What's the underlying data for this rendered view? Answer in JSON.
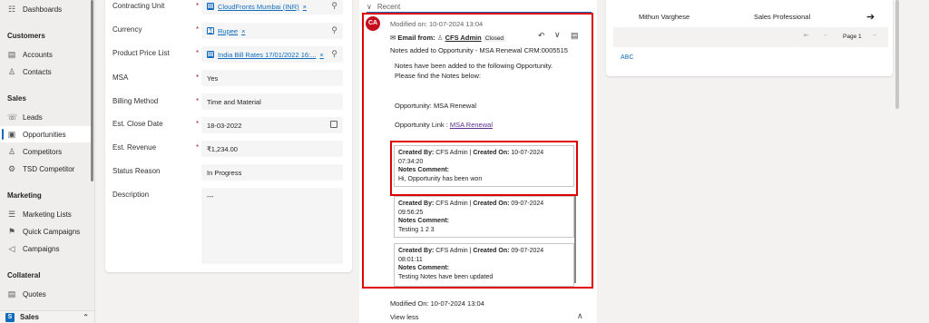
{
  "sidebar": {
    "top_item": "Dashboards",
    "groups": [
      {
        "label": "Customers",
        "items": [
          "Accounts",
          "Contacts"
        ]
      },
      {
        "label": "Sales",
        "items": [
          "Leads",
          "Opportunities",
          "Competitors",
          "TSD Competitor"
        ]
      },
      {
        "label": "Marketing",
        "items": [
          "Marketing Lists",
          "Quick Campaigns",
          "Campaigns"
        ]
      },
      {
        "label": "Collateral",
        "items": [
          "Quotes"
        ]
      }
    ],
    "active_item": "Opportunities",
    "area_badge": "S",
    "area_label": "Sales"
  },
  "form": {
    "fields": [
      {
        "label": "Contracting Unit",
        "value": "CloudFronts Mumbai (INR)",
        "required": "*"
      },
      {
        "label": "Currency",
        "value": "Rupee",
        "required": "*"
      },
      {
        "label": "Product Price List",
        "value": "India Bill Rates 17/01/2022 16:...",
        "required": "*"
      },
      {
        "label": "MSA",
        "value": "Yes",
        "required": "*"
      },
      {
        "label": "Billing Method",
        "value": "Time and Material",
        "required": "*"
      },
      {
        "label": "Est. Close Date",
        "value": "18-03-2022",
        "required": "*"
      },
      {
        "label": "Est. Revenue",
        "value": "₹1,234.00",
        "required": "*"
      },
      {
        "label": "Status Reason",
        "value": "In Progress",
        "required": ""
      },
      {
        "label": "Description",
        "value": "---",
        "required": ""
      }
    ]
  },
  "timeline": {
    "section_label": "Recent",
    "avatar_initials": "CA",
    "modified_on": "Modified on: 10-07-2024 13:04",
    "email_from_label": "Email from:",
    "email_from_user": "CFS Admin",
    "status_badge": "Closed",
    "subject": "Notes added to Opportunity - MSA Renewal CRM:0005515",
    "body_line1": "Notes have been added to the following Opportunity.",
    "body_line2": "Please find the Notes below:",
    "opportunity_line": "Opportunity: MSA Renewal",
    "opportunity_link_label": "Opportunity Link :",
    "opportunity_link_text": "MSA Renewal",
    "notes": [
      {
        "created_by_label": "Created By:",
        "created_by": "CFS Admin",
        "created_on_label": "Created On:",
        "created_on": "10-07-2024",
        "time": "07:34:20",
        "comment_label": "Notes Comment:",
        "comment": "Hi, Opportunity has been won"
      },
      {
        "created_by_label": "Created By:",
        "created_by": "CFS Admin",
        "created_on_label": "Created On:",
        "created_on": "09-07-2024",
        "time": "09:56:25",
        "comment_label": "Notes Comment:",
        "comment": "Testing 1 2 3"
      },
      {
        "created_by_label": "Created By:",
        "created_by": "CFS Admin",
        "created_on_label": "Created On:",
        "created_on": "09-07-2024",
        "time": "08:01:11",
        "comment_label": "Notes Comment:",
        "comment": "Testing Notes have been updated"
      }
    ],
    "footer_modified": "Modified On: 10-07-2024 13:04",
    "view_less": "View less"
  },
  "right_panel": {
    "row_name": "Mithun Varghese",
    "row_role": "Sales Professional",
    "page_label": "Page 1",
    "abc_link": "ABC"
  },
  "colors": {
    "accent": "#0f6cbd",
    "highlight": "#e00000",
    "avatar": "#c50f1f"
  }
}
